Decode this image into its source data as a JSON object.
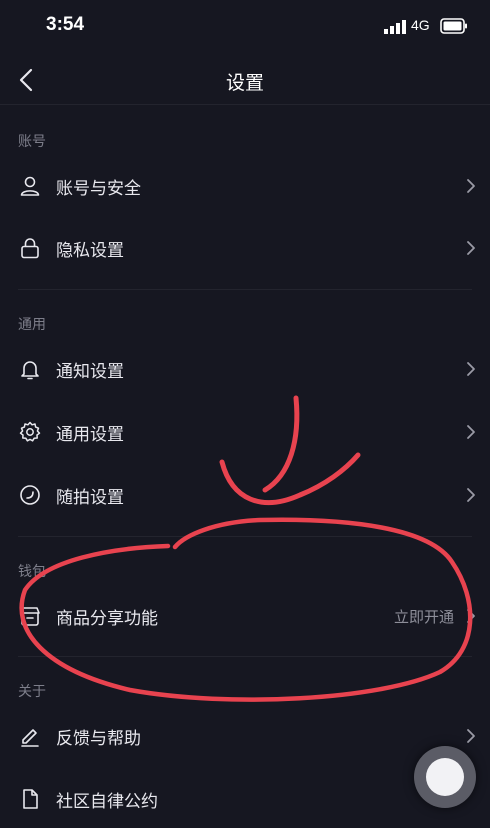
{
  "status_bar": {
    "time": "3:54",
    "network": "4G"
  },
  "nav": {
    "title": "设置"
  },
  "sections": {
    "account": {
      "header": "账号",
      "items": [
        {
          "label": "账号与安全",
          "icon": "user-icon"
        },
        {
          "label": "隐私设置",
          "icon": "lock-icon"
        }
      ]
    },
    "general": {
      "header": "通用",
      "items": [
        {
          "label": "通知设置",
          "icon": "bell-icon"
        },
        {
          "label": "通用设置",
          "icon": "gear-icon"
        },
        {
          "label": "随拍设置",
          "icon": "snap-icon"
        }
      ]
    },
    "wallet": {
      "header": "钱包",
      "items": [
        {
          "label": "商品分享功能",
          "icon": "shop-icon",
          "value": "立即开通"
        }
      ]
    },
    "about": {
      "header": "关于",
      "items": [
        {
          "label": "反馈与帮助",
          "icon": "edit-icon"
        },
        {
          "label": "社区自律公约",
          "icon": "document-icon"
        }
      ]
    }
  },
  "colors": {
    "background": "#161721",
    "annotation": "#e8434f"
  }
}
